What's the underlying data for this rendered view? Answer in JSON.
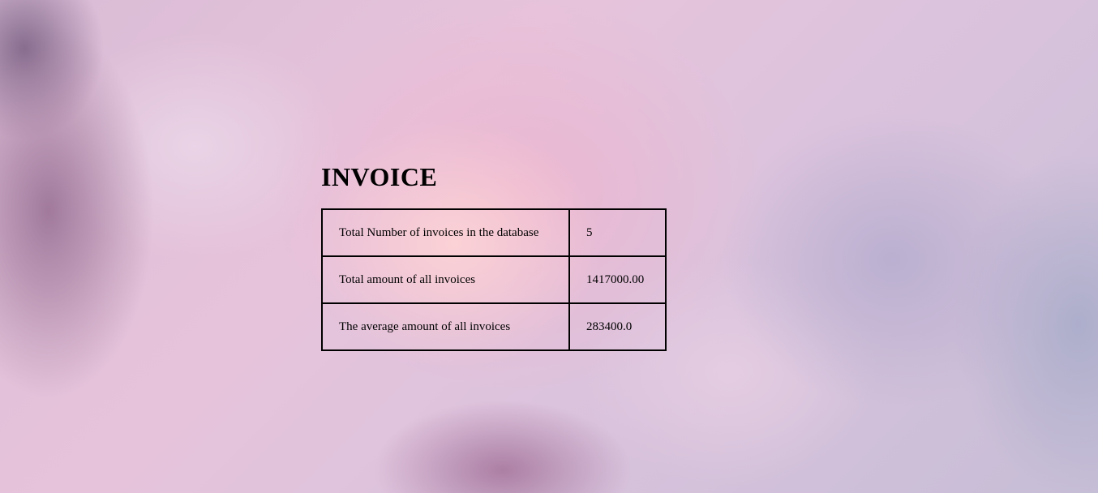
{
  "page": {
    "title": "INVOICE"
  },
  "stats": {
    "rows": [
      {
        "label": "Total Number of invoices in the database",
        "value": "5"
      },
      {
        "label": "Total amount of all invoices",
        "value": "1417000.00"
      },
      {
        "label": "The average amount of all invoices",
        "value": "283400.0"
      }
    ]
  }
}
